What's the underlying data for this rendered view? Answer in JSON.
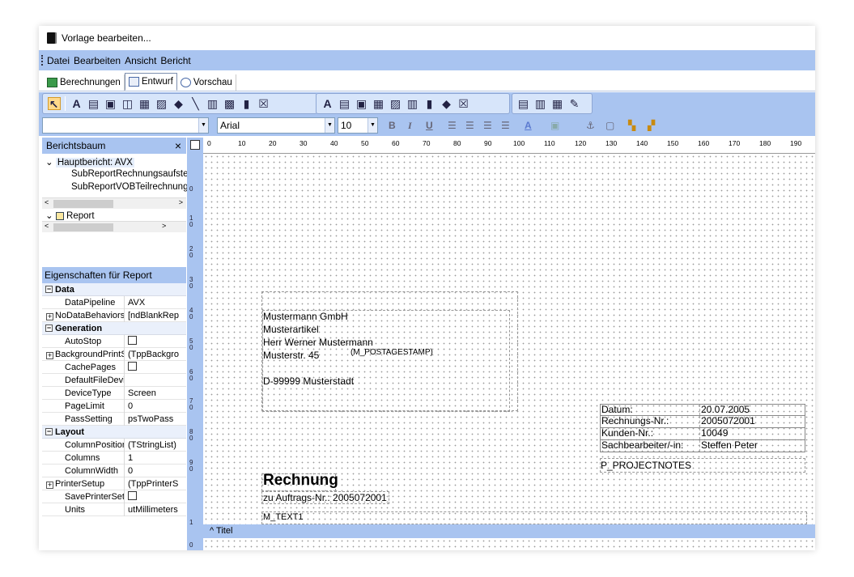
{
  "window": {
    "title": "Vorlage bearbeiten..."
  },
  "menu": [
    "Datei",
    "Bearbeiten",
    "Ansicht",
    "Bericht"
  ],
  "tabs": [
    {
      "label": "Berechnungen",
      "icon": "calculator-icon"
    },
    {
      "label": "Entwurf",
      "icon": "design-icon",
      "active": true
    },
    {
      "label": "Vorschau",
      "icon": "preview-icon"
    }
  ],
  "format": {
    "font": "Arial",
    "size": "10",
    "bold": "B",
    "italic": "I",
    "underline": "U"
  },
  "tree": {
    "title": "Berichtsbaum",
    "close": "×",
    "root": "Hauptbericht: AVX",
    "children": [
      "SubReportRechnungsaufste",
      "SubReportVOBTeilrechnung"
    ],
    "report": "Report"
  },
  "properties": {
    "title": "Eigenschaften für Report",
    "groups": [
      {
        "name": "Data",
        "items": [
          {
            "name": "DataPipeline",
            "value": "AVX"
          },
          {
            "name": "NoDataBehaviors",
            "value": "[ndBlankRep",
            "expandable": true
          }
        ]
      },
      {
        "name": "Generation",
        "items": [
          {
            "name": "AutoStop",
            "value": "",
            "checkbox": true
          },
          {
            "name": "BackgroundPrintSe",
            "value": "(TppBackgro",
            "expandable": true
          },
          {
            "name": "CachePages",
            "value": "",
            "checkbox": true
          },
          {
            "name": "DefaultFileDeviceT",
            "value": ""
          },
          {
            "name": "DeviceType",
            "value": "Screen"
          },
          {
            "name": "PageLimit",
            "value": "0"
          },
          {
            "name": "PassSetting",
            "value": "psTwoPass"
          }
        ]
      },
      {
        "name": "Layout",
        "items": [
          {
            "name": "ColumnPositions",
            "value": "(TStringList)"
          },
          {
            "name": "Columns",
            "value": "1"
          },
          {
            "name": "ColumnWidth",
            "value": "0"
          },
          {
            "name": "PrinterSetup",
            "value": "(TppPrinterS",
            "expandable": true
          },
          {
            "name": "SavePrinterSetup",
            "value": "",
            "checkbox": true
          },
          {
            "name": "Units",
            "value": "utMillimeters"
          }
        ]
      }
    ]
  },
  "ruler": {
    "h": [
      "0",
      "10",
      "20",
      "30",
      "40",
      "50",
      "60",
      "70",
      "80",
      "90",
      "100",
      "110",
      "120",
      "130",
      "140",
      "150",
      "160",
      "170",
      "180",
      "190"
    ],
    "v": [
      "0",
      "1\n0",
      "2\n0",
      "3\n0",
      "4\n0",
      "5\n0",
      "6\n0",
      "7\n0",
      "8\n0",
      "9\n0",
      "1\n0",
      "0"
    ]
  },
  "document": {
    "address": [
      "Mustermann GmbH",
      "Musterartikel",
      "Herr Werner Mustermann",
      "Musterstr. 45",
      "",
      "D-99999 Musterstadt"
    ],
    "postage": "(M_POSTAGESTAMP)",
    "info": [
      {
        "label": "Datum:",
        "value": "20.07.2005"
      },
      {
        "label": "Rechnungs-Nr.:",
        "value": "2005072001"
      },
      {
        "label": "Kunden-Nr.:",
        "value": "10049"
      },
      {
        "label": "Sachbearbeiter/-in:",
        "value": "Steffen Peter"
      }
    ],
    "notes": "P_PROJECTNOTES",
    "heading": "Rechnung",
    "order": "zu Auftrags-Nr.: 2005072001",
    "mtext": "M_TEXT1"
  },
  "band": {
    "label": "^ Titel"
  }
}
